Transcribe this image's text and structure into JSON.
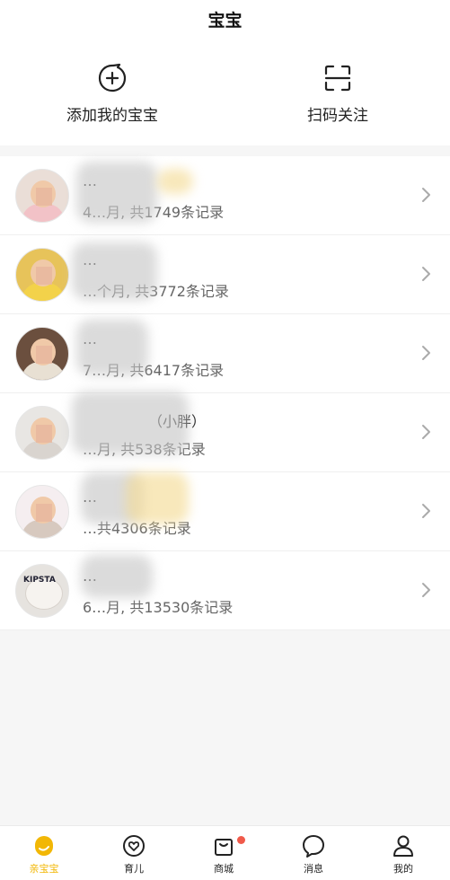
{
  "header": {
    "title": "宝宝"
  },
  "actions": [
    {
      "label": "添加我的宝宝",
      "icon": "add-chat-icon"
    },
    {
      "label": "扫码关注",
      "icon": "scan-icon"
    }
  ],
  "babies": [
    {
      "name": "…",
      "meta": "4…月, 共1749条记录"
    },
    {
      "name": "…",
      "meta": "…个月, 共3772条记录"
    },
    {
      "name": "…",
      "meta": "7…月, 共6417条记录"
    },
    {
      "name": "（小胖）",
      "meta": "…月, 共538条记录"
    },
    {
      "name": "…",
      "meta": "…共4306条记录"
    },
    {
      "name": "…",
      "meta": "6…月, 共13530条记录"
    }
  ],
  "avatar_texts": {
    "brand": "KIPSTA"
  },
  "tabs": [
    {
      "label": "亲宝宝",
      "icon": "home-icon",
      "active": true
    },
    {
      "label": "育儿",
      "icon": "heart-icon",
      "active": false
    },
    {
      "label": "商城",
      "icon": "bag-icon",
      "active": false,
      "badge": true
    },
    {
      "label": "消息",
      "icon": "chat-bubble-icon",
      "active": false
    },
    {
      "label": "我的",
      "icon": "user-icon",
      "active": false
    }
  ],
  "colors": {
    "accent": "#f2b705",
    "badge": "#f05a4a"
  }
}
